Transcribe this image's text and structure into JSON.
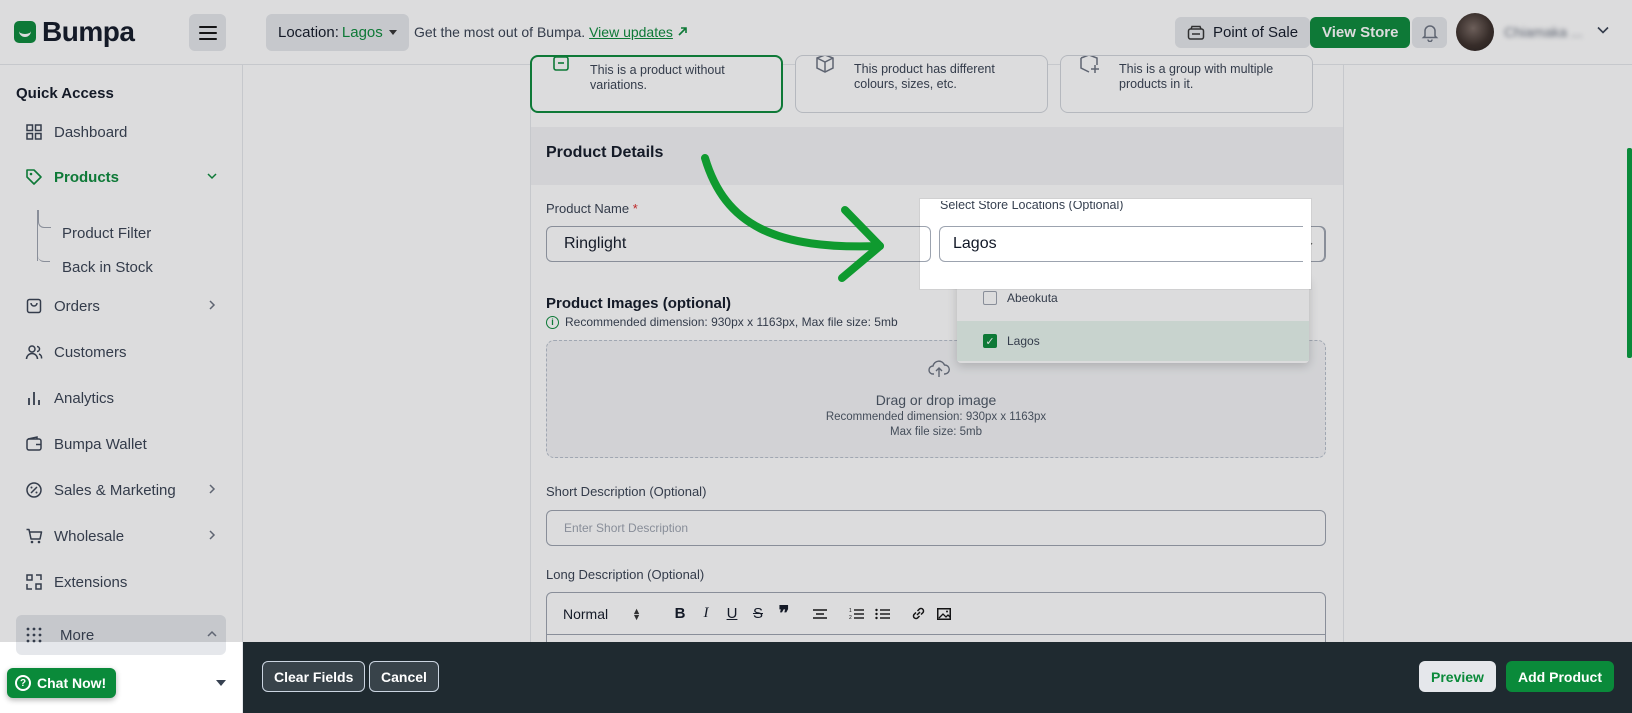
{
  "app": {
    "logo_text": "Bumpa",
    "brand_color": "#0a8a3a"
  },
  "header": {
    "location_label": "Location:",
    "location_value": "Lagos",
    "promo_text": "Get the most out of Bumpa.",
    "promo_link": "View updates",
    "pos_label": "Point of Sale",
    "view_store_label": "View Store",
    "username": "Chiamaka ..."
  },
  "sidebar": {
    "title": "Quick Access",
    "items": [
      {
        "label": "Dashboard",
        "icon": "grid-icon"
      },
      {
        "label": "Products",
        "icon": "tag-icon",
        "active": true
      },
      {
        "label": "Orders",
        "icon": "bag-icon"
      },
      {
        "label": "Customers",
        "icon": "users-icon"
      },
      {
        "label": "Analytics",
        "icon": "bar-chart-icon"
      },
      {
        "label": "Bumpa Wallet",
        "icon": "wallet-icon"
      },
      {
        "label": "Sales & Marketing",
        "icon": "percent-icon"
      },
      {
        "label": "Wholesale",
        "icon": "cart-icon"
      },
      {
        "label": "Extensions",
        "icon": "puzzle-icon"
      },
      {
        "label": "More",
        "icon": "dots-grid-icon"
      }
    ],
    "sub_items": [
      "Product Filter",
      "Back in Stock"
    ],
    "chat_label": "Chat Now!"
  },
  "form": {
    "type_cards": [
      "This is a product without variations.",
      "This product has different colours, sizes, etc.",
      "This is a group with multiple products in it."
    ],
    "section_title": "Product Details",
    "product_name_label": "Product Name",
    "required_mark": "*",
    "product_name_value": "Ringlight",
    "images_title": "Product Images (optional)",
    "images_hint": "Recommended dimension: 930px x 1163px, Max file size: 5mb",
    "dropzone_title": "Drag or drop image",
    "dropzone_line1": "Recommended dimension: 930px x 1163px",
    "dropzone_line2": "Max file size: 5mb",
    "short_desc_label": "Short Description (Optional)",
    "short_desc_placeholder": "Enter Short Description",
    "long_desc_label": "Long Description (Optional)",
    "editor_format": "Normal"
  },
  "store_select": {
    "label": "Select Store Locations (Optional)",
    "value": "Lagos",
    "options": [
      {
        "label": "Abeokuta",
        "checked": false
      },
      {
        "label": "Lagos",
        "checked": true
      }
    ]
  },
  "footer": {
    "clear_label": "Clear Fields",
    "cancel_label": "Cancel",
    "preview_label": "Preview",
    "add_label": "Add Product"
  }
}
